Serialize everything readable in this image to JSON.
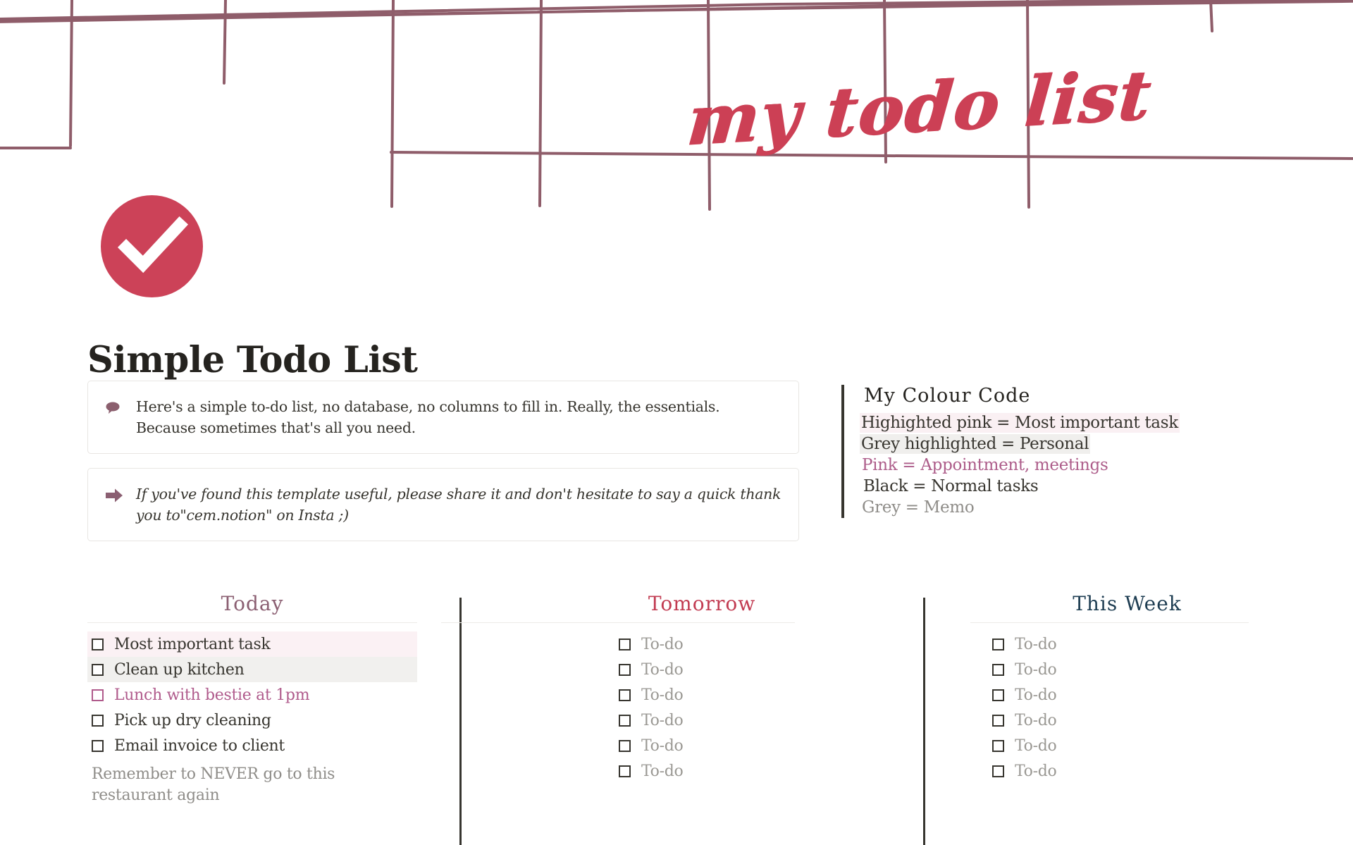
{
  "banner": {
    "script_title": "my todo list",
    "script_color": "#cc4055",
    "grid_color": "#8f5d6a"
  },
  "page": {
    "icon": "check-circle-icon",
    "icon_color": "#cc4258",
    "title": "Simple Todo List"
  },
  "callouts": [
    {
      "icon": "speech-bubble-icon",
      "icon_color": "#8b5f6e",
      "text": "Here's a simple to-do list, no database, no columns to fill in. Really, the essentials. Because sometimes that's all you need.",
      "italic": false
    },
    {
      "icon": "right-arrow-icon",
      "icon_color": "#8b5f72",
      "text": "If you've found this template useful, please share it and don't hesitate to say a quick thank you to\"cem.notion\" on Insta ;)",
      "italic": true
    }
  ],
  "colour_code": {
    "title": "My Colour Code",
    "lines": [
      {
        "text": "Highighted pink = Most important task",
        "style": "hl-pink"
      },
      {
        "text": "Grey highlighted = Personal",
        "style": "hl-grey"
      },
      {
        "text": "Pink = Appointment, meetings",
        "style": "pink",
        "color": "#ad5d8a"
      },
      {
        "text": "Black = Normal tasks",
        "style": "black",
        "color": "#37352f"
      },
      {
        "text": "Grey = Memo",
        "style": "grey",
        "color": "#8f8d89"
      }
    ]
  },
  "columns": [
    {
      "heading": "Today",
      "heading_color": "#8b5f72",
      "items": [
        {
          "label": "Most important task",
          "style": "hl-pink"
        },
        {
          "label": "Clean up kitchen",
          "style": "hl-grey"
        },
        {
          "label": "Lunch with bestie at 1pm",
          "style": "pink"
        },
        {
          "label": "Pick up dry cleaning",
          "style": "normal"
        },
        {
          "label": "Email invoice to client",
          "style": "normal"
        }
      ],
      "memo": "Remember to NEVER go to this restaurant again"
    },
    {
      "heading": "Tomorrow",
      "heading_color": "#c23c52",
      "items": [
        {
          "label": "To-do",
          "style": "placeholder"
        },
        {
          "label": "To-do",
          "style": "placeholder"
        },
        {
          "label": "To-do",
          "style": "placeholder"
        },
        {
          "label": "To-do",
          "style": "placeholder"
        },
        {
          "label": "To-do",
          "style": "placeholder"
        },
        {
          "label": "To-do",
          "style": "placeholder"
        }
      ],
      "memo": ""
    },
    {
      "heading": "This Week",
      "heading_color": "#1e3d52",
      "items": [
        {
          "label": "To-do",
          "style": "placeholder"
        },
        {
          "label": "To-do",
          "style": "placeholder"
        },
        {
          "label": "To-do",
          "style": "placeholder"
        },
        {
          "label": "To-do",
          "style": "placeholder"
        },
        {
          "label": "To-do",
          "style": "placeholder"
        },
        {
          "label": "To-do",
          "style": "placeholder"
        }
      ],
      "memo": ""
    }
  ]
}
